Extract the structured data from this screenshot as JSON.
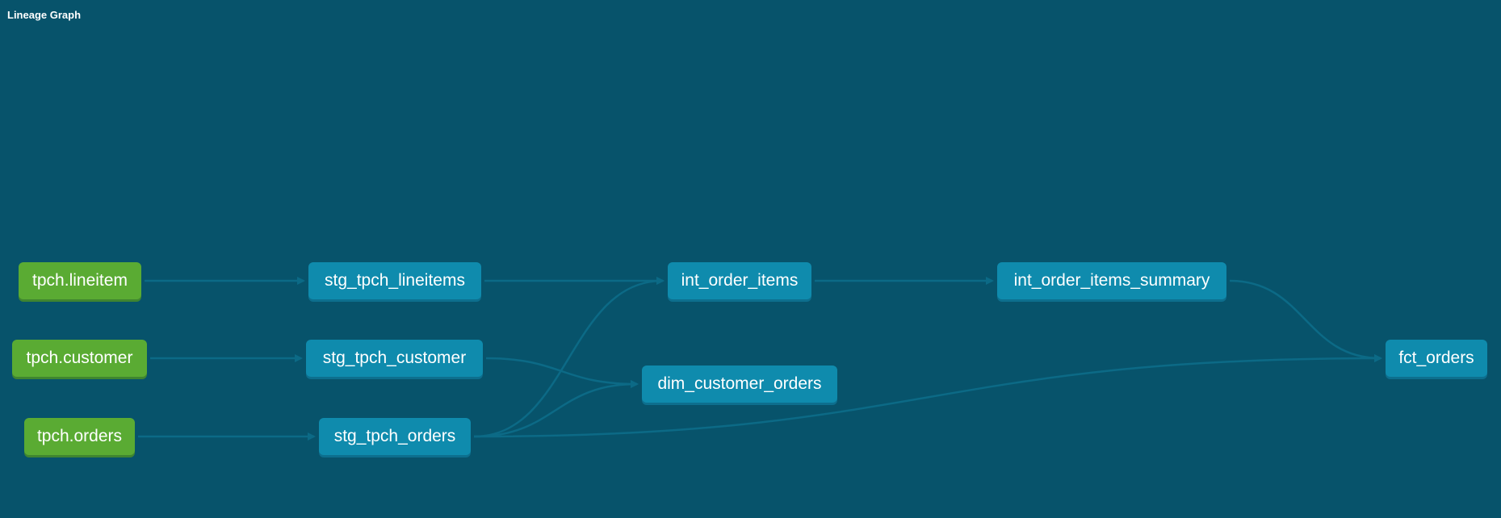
{
  "header": {
    "title": "Lineage Graph"
  },
  "colors": {
    "background": "#07536b",
    "source_node": "#5aab33",
    "model_node": "#0f8bad",
    "edge": "#0c6a86"
  },
  "nodes": [
    {
      "id": "tpch_lineitem",
      "label": "tpch.lineitem",
      "type": "source"
    },
    {
      "id": "tpch_customer",
      "label": "tpch.customer",
      "type": "source"
    },
    {
      "id": "tpch_orders",
      "label": "tpch.orders",
      "type": "source"
    },
    {
      "id": "stg_tpch_lineitems",
      "label": "stg_tpch_lineitems",
      "type": "model"
    },
    {
      "id": "stg_tpch_customer",
      "label": "stg_tpch_customer",
      "type": "model"
    },
    {
      "id": "stg_tpch_orders",
      "label": "stg_tpch_orders",
      "type": "model"
    },
    {
      "id": "int_order_items",
      "label": "int_order_items",
      "type": "model"
    },
    {
      "id": "dim_customer_orders",
      "label": "dim_customer_orders",
      "type": "model"
    },
    {
      "id": "int_order_items_summary",
      "label": "int_order_items_summary",
      "type": "model"
    },
    {
      "id": "fct_orders",
      "label": "fct_orders",
      "type": "model"
    }
  ],
  "edges": [
    [
      "tpch_lineitem",
      "stg_tpch_lineitems"
    ],
    [
      "tpch_customer",
      "stg_tpch_customer"
    ],
    [
      "tpch_orders",
      "stg_tpch_orders"
    ],
    [
      "stg_tpch_lineitems",
      "int_order_items"
    ],
    [
      "stg_tpch_orders",
      "int_order_items"
    ],
    [
      "stg_tpch_customer",
      "dim_customer_orders"
    ],
    [
      "stg_tpch_orders",
      "dim_customer_orders"
    ],
    [
      "int_order_items",
      "int_order_items_summary"
    ],
    [
      "int_order_items_summary",
      "fct_orders"
    ],
    [
      "stg_tpch_orders",
      "fct_orders"
    ]
  ]
}
